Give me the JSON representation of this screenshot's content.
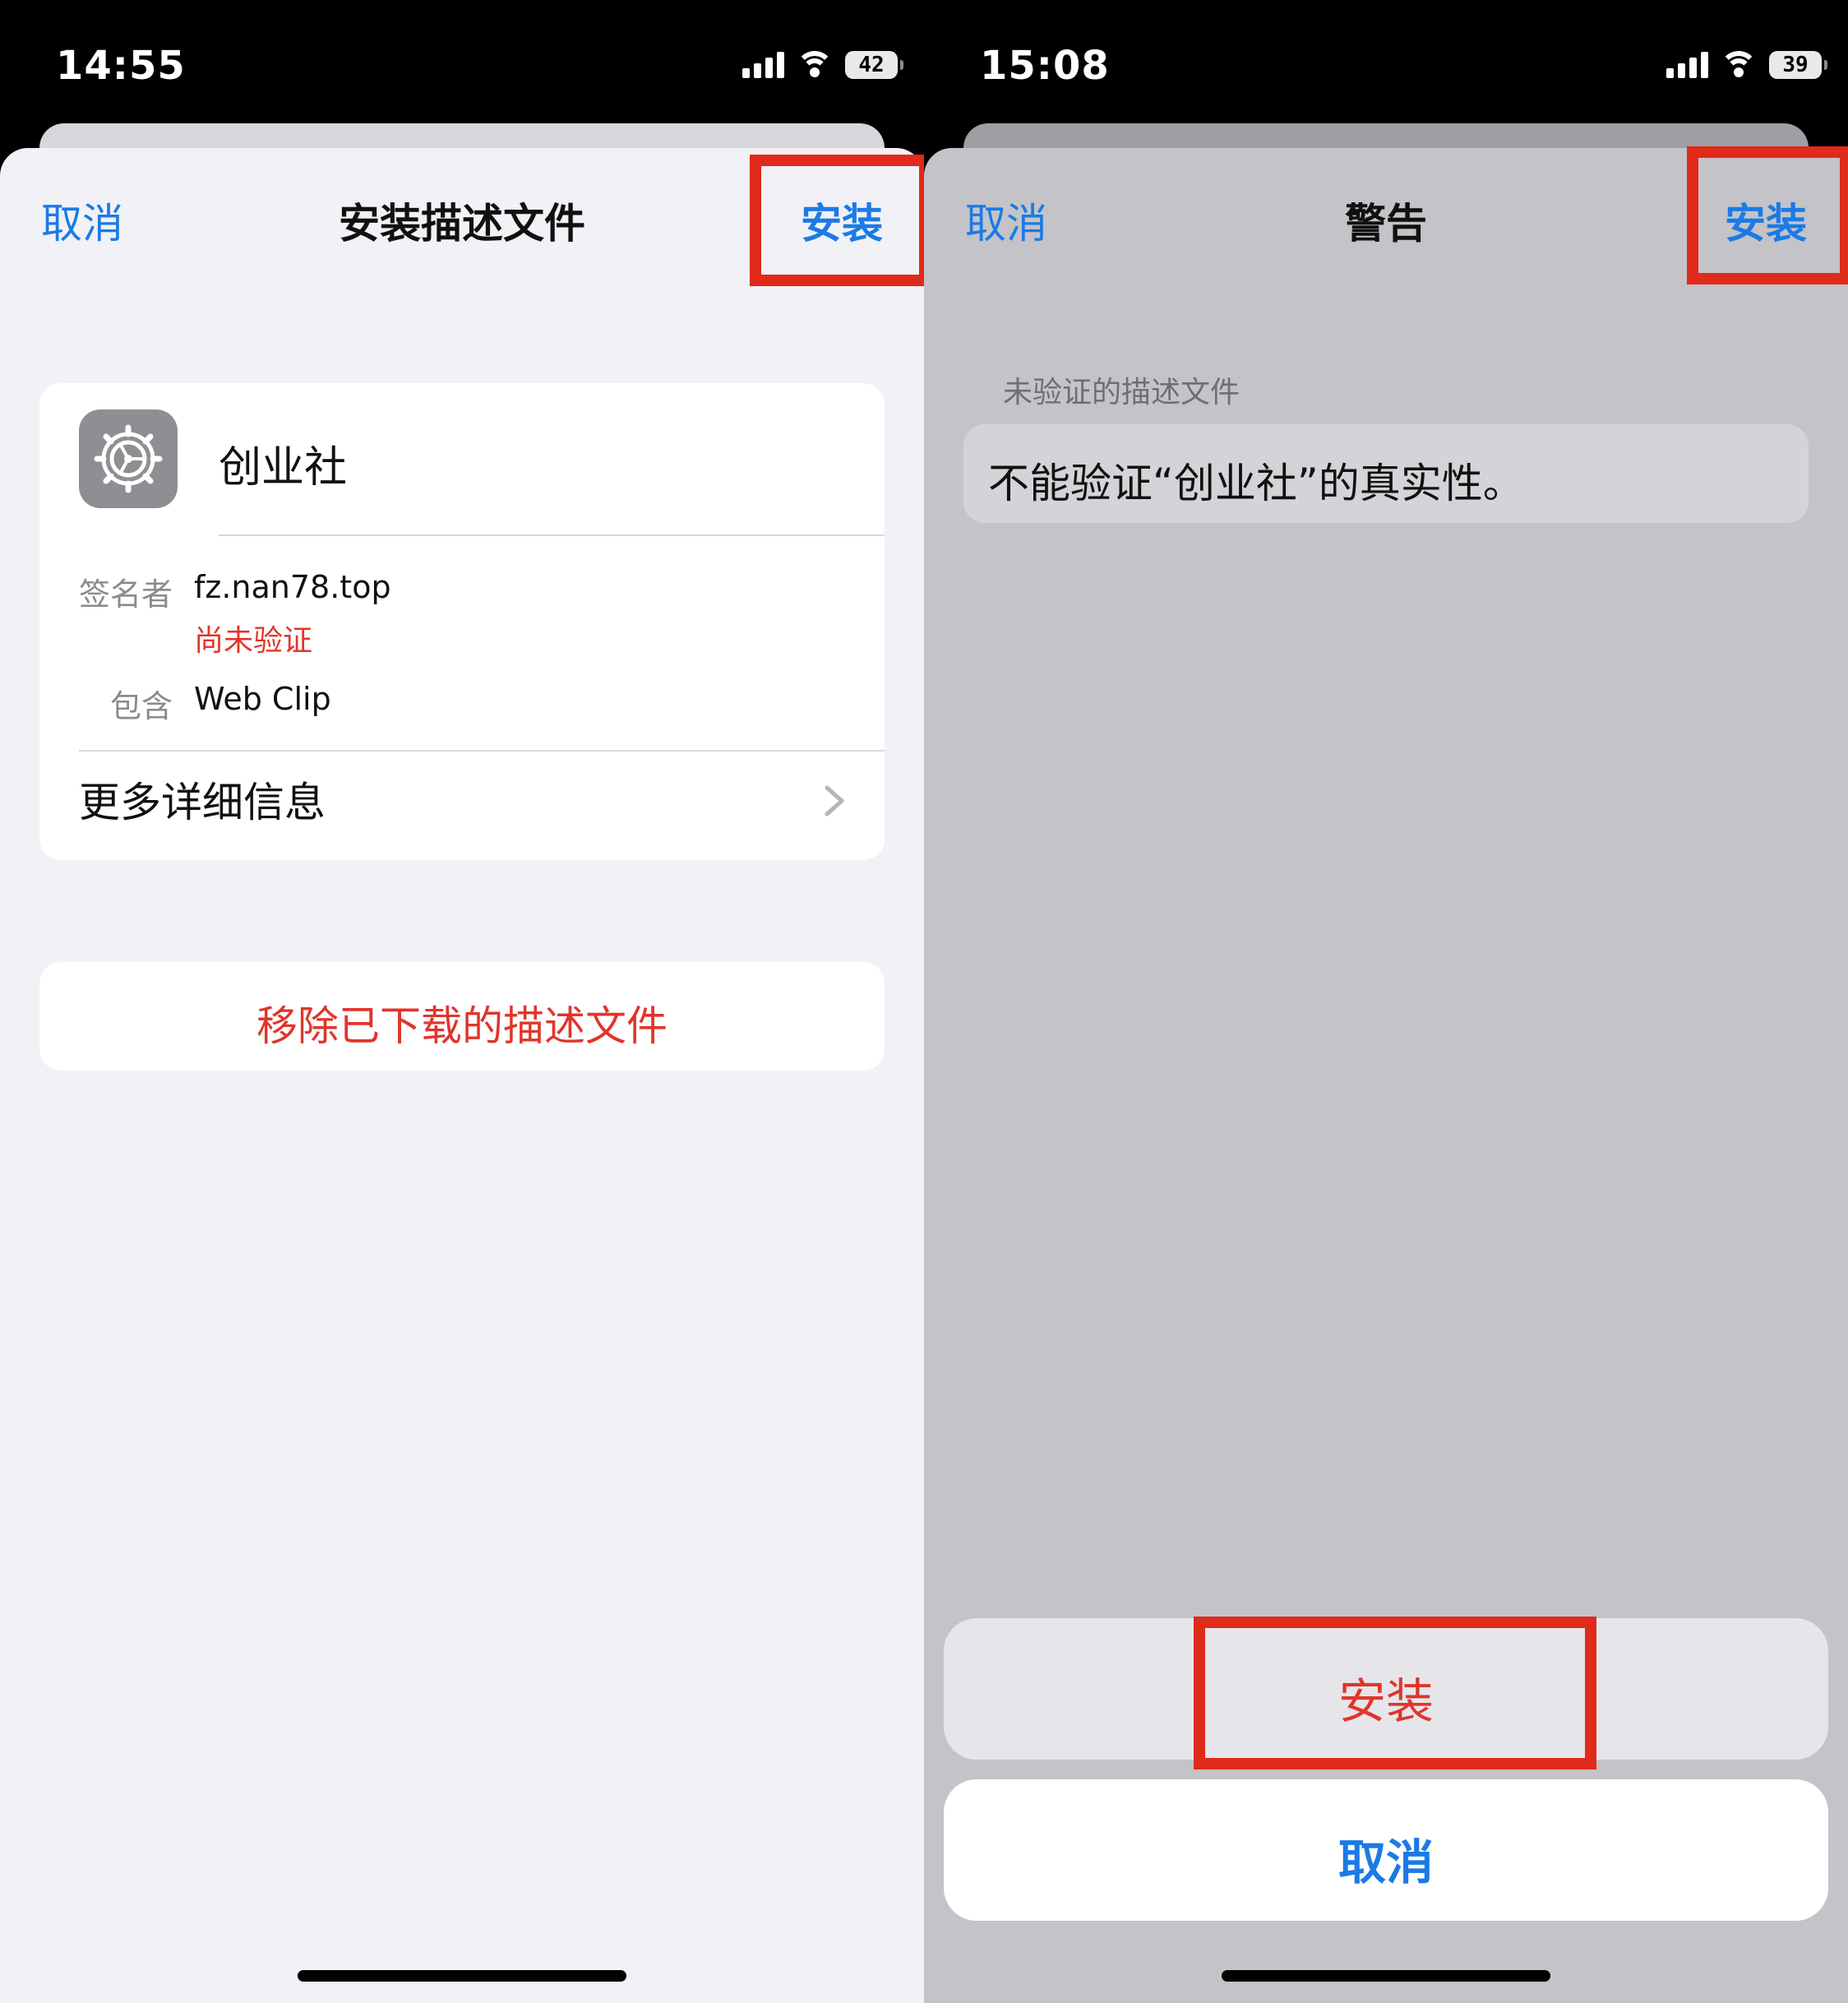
{
  "left": {
    "status": {
      "time": "14:55",
      "battery": "42"
    },
    "nav": {
      "cancel": "取消",
      "title": "安装描述文件",
      "install": "安装"
    },
    "profile": {
      "icon": "gear-icon",
      "name": "创业社",
      "signer_label": "签名者",
      "signer_value": "fz.nan78.top",
      "signer_status": "尚未验证",
      "contains_label": "包含",
      "contains_value": "Web Clip",
      "more_info": "更多详细信息"
    },
    "remove_button": "移除已下载的描述文件"
  },
  "right": {
    "status": {
      "time": "15:08",
      "battery": "39"
    },
    "nav": {
      "cancel": "取消",
      "title": "警告",
      "install": "安装"
    },
    "warning": {
      "caption": "未验证的描述文件",
      "message": "不能验证“创业社”的真实性。"
    },
    "action_sheet": {
      "install": "安装",
      "cancel": "取消"
    }
  },
  "colors": {
    "accent_blue": "#1b7ae6",
    "destructive_red": "#e0352b",
    "highlight_red": "#e02a1a"
  }
}
